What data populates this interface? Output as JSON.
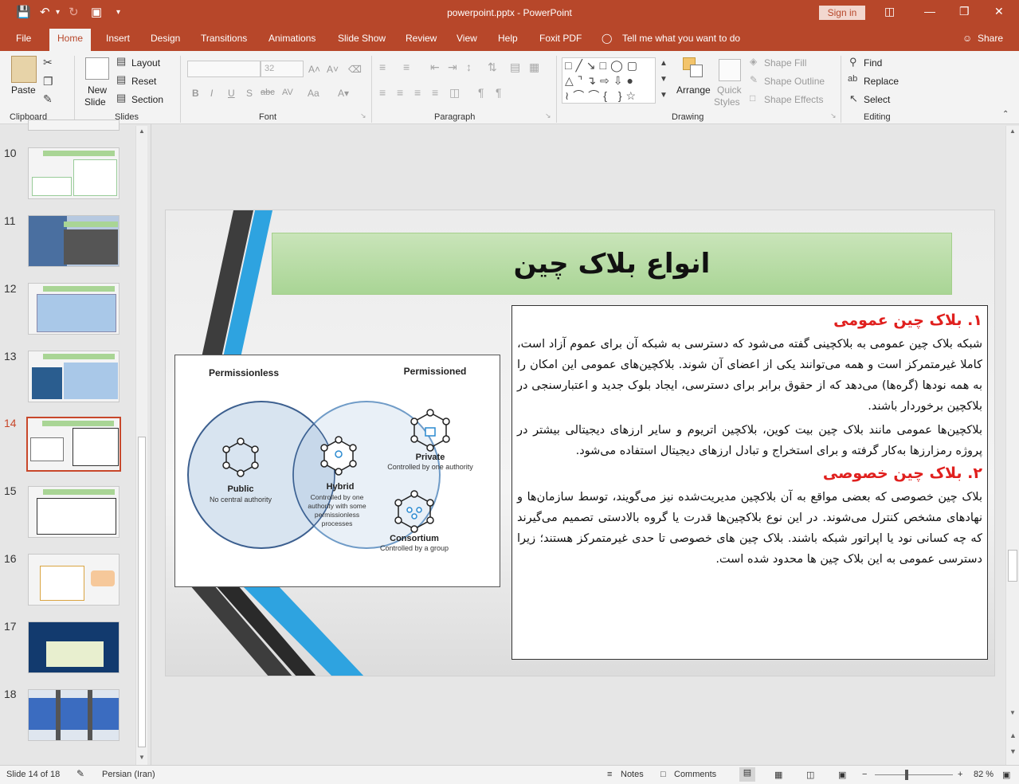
{
  "window": {
    "doc_title": "powerpoint.pptx  -  PowerPoint",
    "signin_label": "Sign in"
  },
  "tabs": [
    "File",
    "Home",
    "Insert",
    "Design",
    "Transitions",
    "Animations",
    "Slide Show",
    "Review",
    "View",
    "Help",
    "Foxit PDF"
  ],
  "tell_me": "Tell me what you want to do",
  "share_label": "Share",
  "ribbon": {
    "clipboard": {
      "label": "Clipboard",
      "paste": "Paste"
    },
    "slides": {
      "label": "Slides",
      "new_slide_1": "New",
      "new_slide_2": "Slide",
      "layout": "Layout",
      "reset": "Reset",
      "section": "Section"
    },
    "font": {
      "label": "Font",
      "size": "32",
      "bold": "B",
      "italic": "I",
      "underline": "U",
      "shadow": "S",
      "strike": "abc",
      "spacing": "AV",
      "case": "Aa"
    },
    "paragraph": {
      "label": "Paragraph"
    },
    "drawing": {
      "label": "Drawing",
      "arrange": "Arrange",
      "quick_styles_1": "Quick",
      "quick_styles_2": "Styles",
      "shape_fill": "Shape Fill",
      "shape_outline": "Shape Outline",
      "shape_effects": "Shape Effects"
    },
    "editing": {
      "label": "Editing",
      "find": "Find",
      "replace": "Replace",
      "select": "Select"
    }
  },
  "thumbnails": [
    {
      "num": "10"
    },
    {
      "num": "11"
    },
    {
      "num": "12"
    },
    {
      "num": "13"
    },
    {
      "num": "14",
      "selected": true
    },
    {
      "num": "15"
    },
    {
      "num": "16"
    },
    {
      "num": "17"
    },
    {
      "num": "18"
    }
  ],
  "slide": {
    "title": "انواع بلاک چین",
    "h1": "۱. بلاک چین عمومی",
    "p1": "شبکه بلاک چین عمومی به بلاکچینی گفته می‌شود که دسترسی به شبکه آن برای عموم آزاد است، کاملا غیرمتمرکز است و همه می‌توانند یکی از اعضای آن شوند. بلاکچین‌های عمومی این امکان را به همه نودها (گره‌ها) می‌دهد که از حقوق برابر برای دسترسی، ایجاد بلوک جدید و اعتبارسنجی در بلاکچین برخوردار باشند.",
    "p2": "بلاکچین‌ها عمومی مانند بلاک چین بیت کوین، بلاکچین اتریوم و سایر ارزهای دیجیتالی بیشتر در پروژه رمزارزها به‌کار گرفته و برای استخراج و تبادل ارزهای دیجیتال استفاده می‌شود.",
    "h2": "۲. بلاک چین خصوصی",
    "p3": "بلاک چین خصوصی که بعضی مواقع به آن بلاکچین مدیریت‌شده نیز می‌گویند، توسط سازمان‌ها و نهادهای مشخص کنترل می‌شوند. در این نوع بلاکچین‌ها قدرت یا گروه بالادستی تصمیم می‌گیرند که چه کسانی نود یا اپراتور شبکه باشند. بلاک چین های خصوصی تا حدی غیرمتمرکز هستند؛ زیرا دسترسی عمومی به این بلاک چین ها محدود شده است.",
    "diagram": {
      "permissionless": "Permissionless",
      "permissioned": "Permissioned",
      "public": "Public",
      "public_sub": "No central authority",
      "hybrid": "Hybrid",
      "hybrid_sub1": "Controlled by one",
      "hybrid_sub2": "authority with some",
      "hybrid_sub3": "permissionless",
      "hybrid_sub4": "processes",
      "private": "Private",
      "private_sub": "Controlled by one authority",
      "consortium": "Consortium",
      "consortium_sub": "Controlled by a group"
    }
  },
  "status": {
    "slide_of": "Slide 14 of 18",
    "language": "Persian (Iran)",
    "notes": "Notes",
    "comments": "Comments",
    "zoom": "82 %"
  },
  "colors": {
    "accent": "#b7472a",
    "title_green": "#a9d595",
    "heading_red": "#e0201e"
  }
}
